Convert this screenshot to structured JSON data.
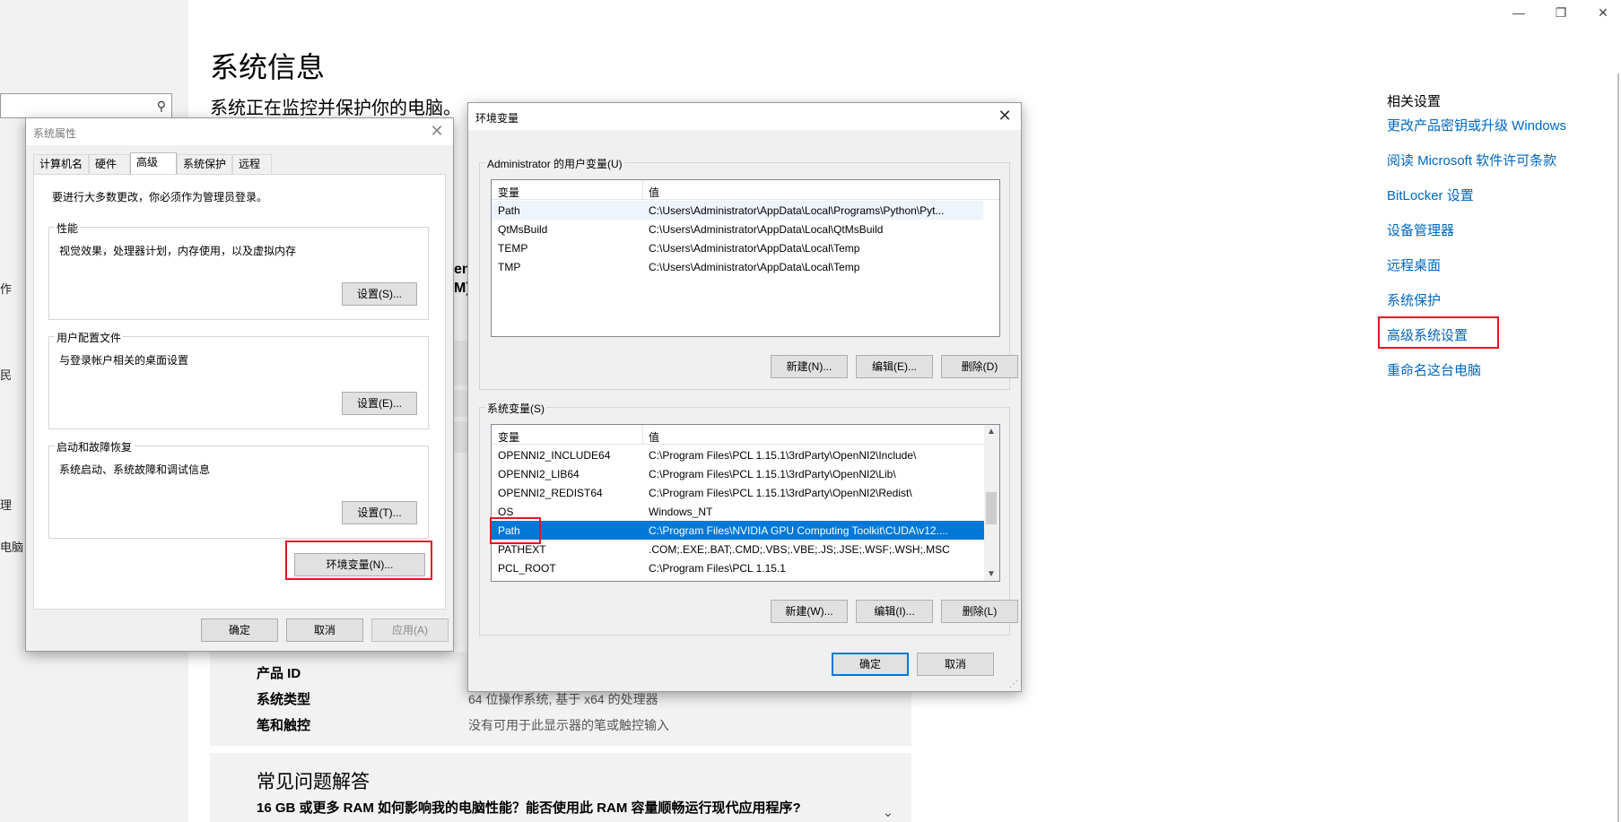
{
  "window_controls": {
    "minimize": "—",
    "restore": "❐",
    "close": "✕"
  },
  "left_pane": {
    "search_icon": "⚲",
    "fragments": [
      "作",
      "民",
      "理",
      "电脑"
    ]
  },
  "page": {
    "title": "系统信息",
    "subtitle": "系统正在监控并保护你的电脑。",
    "obscured_fragments": [
      "en",
      "M)"
    ],
    "specs": [
      {
        "label": "产品 ID",
        "value": ""
      },
      {
        "label": "系统类型",
        "value": "64 位操作系统, 基于 x64 的处理器"
      },
      {
        "label": "笔和触控",
        "value": "没有可用于此显示器的笔或触控输入"
      }
    ],
    "faq_title": "常见问题解答",
    "faq_question": "16 GB 或更多 RAM 如何影响我的电脑性能？能否使用此 RAM 容量顺畅运行现代应用程序?",
    "faq_chevron": "⌄"
  },
  "related": {
    "title": "相关设置",
    "links": [
      "更改产品密钥或升级 Windows",
      "阅读 Microsoft 软件许可条款",
      "BitLocker 设置",
      "设备管理器",
      "远程桌面",
      "系统保护",
      "高级系统设置",
      "重命名这台电脑"
    ]
  },
  "sysprop": {
    "title": "系统属性",
    "close": "✕",
    "tabs": [
      "计算机名",
      "硬件",
      "高级",
      "系统保护",
      "远程"
    ],
    "active_tab": "高级",
    "admin_note": "要进行大多数更改，你必须作为管理员登录。",
    "groups": [
      {
        "legend": "性能",
        "desc": "视觉效果，处理器计划，内存使用，以及虚拟内存",
        "button": "设置(S)..."
      },
      {
        "legend": "用户配置文件",
        "desc": "与登录帐户相关的桌面设置",
        "button": "设置(E)..."
      },
      {
        "legend": "启动和故障恢复",
        "desc": "系统启动、系统故障和调试信息",
        "button": "设置(T)..."
      }
    ],
    "env_button": "环境变量(N)...",
    "ok": "确定",
    "cancel": "取消",
    "apply": "应用(A)"
  },
  "envvars": {
    "title": "环境变量",
    "close": "✕",
    "user_group": "Administrator 的用户变量(U)",
    "col_var": "变量",
    "col_val": "值",
    "user_rows": [
      {
        "name": "Path",
        "value": "C:\\Users\\Administrator\\AppData\\Local\\Programs\\Python\\Pyt..."
      },
      {
        "name": "QtMsBuild",
        "value": "C:\\Users\\Administrator\\AppData\\Local\\QtMsBuild"
      },
      {
        "name": "TEMP",
        "value": "C:\\Users\\Administrator\\AppData\\Local\\Temp"
      },
      {
        "name": "TMP",
        "value": "C:\\Users\\Administrator\\AppData\\Local\\Temp"
      }
    ],
    "user_buttons": {
      "new": "新建(N)...",
      "edit": "编辑(E)...",
      "delete": "删除(D)"
    },
    "system_group": "系统变量(S)",
    "system_rows": [
      {
        "name": "OPENNI2_INCLUDE64",
        "value": "C:\\Program Files\\PCL 1.15.1\\3rdParty\\OpenNI2\\Include\\"
      },
      {
        "name": "OPENNI2_LIB64",
        "value": "C:\\Program Files\\PCL 1.15.1\\3rdParty\\OpenNI2\\Lib\\"
      },
      {
        "name": "OPENNI2_REDIST64",
        "value": "C:\\Program Files\\PCL 1.15.1\\3rdParty\\OpenNI2\\Redist\\"
      },
      {
        "name": "OS",
        "value": "Windows_NT"
      },
      {
        "name": "Path",
        "value": "C:\\Program Files\\NVIDIA GPU Computing Toolkit\\CUDA\\v12...."
      },
      {
        "name": "PATHEXT",
        "value": ".COM;.EXE;.BAT;.CMD;.VBS;.VBE;.JS;.JSE;.WSF;.WSH;.MSC"
      },
      {
        "name": "PCL_ROOT",
        "value": "C:\\Program Files\\PCL 1.15.1"
      }
    ],
    "system_buttons": {
      "new": "新建(W)...",
      "edit": "编辑(I)...",
      "delete": "删除(L)"
    },
    "scroll_up": "▲",
    "scroll_down": "▼",
    "ok": "确定",
    "cancel": "取消",
    "grip": "⋰"
  },
  "colors": {
    "link": "#0067c0",
    "highlight_box": "#e81123",
    "selection": "#0078d7"
  }
}
